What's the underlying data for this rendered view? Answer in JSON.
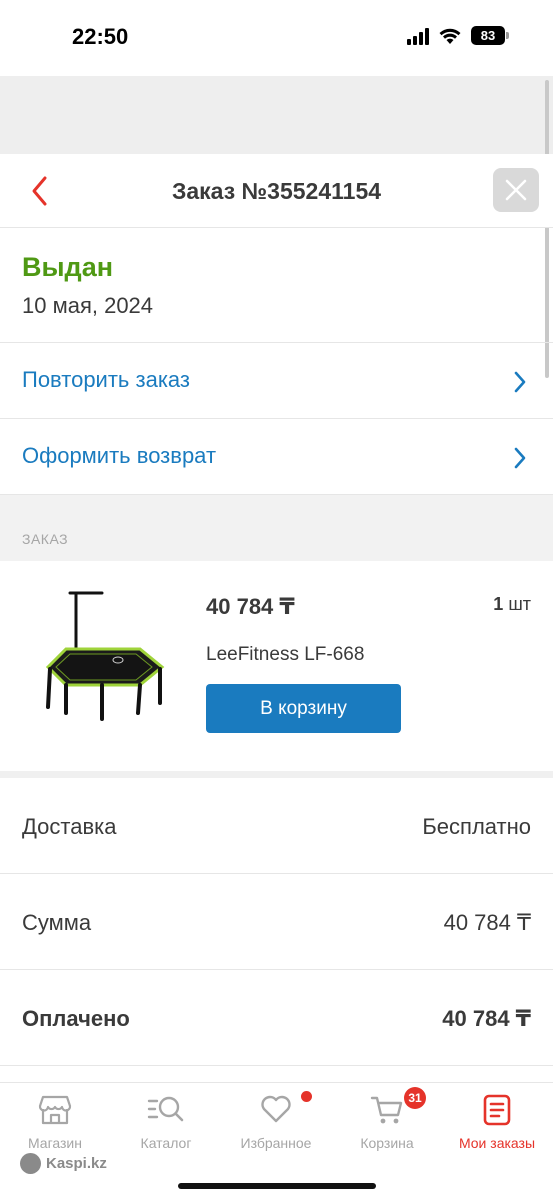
{
  "status_bar": {
    "time": "22:50",
    "battery": "83",
    "icons": [
      "signal-icon",
      "wifi-icon",
      "battery-icon"
    ]
  },
  "header": {
    "title": "Заказ №355241154",
    "back_icon": "chevron-left-icon",
    "close_icon": "close-icon"
  },
  "order_status": {
    "label": "Выдан",
    "date": "10 мая, 2024"
  },
  "actions": [
    {
      "label": "Повторить заказ",
      "icon": "chevron-right-icon"
    },
    {
      "label": "Оформить возврат",
      "icon": "chevron-right-icon"
    }
  ],
  "section": {
    "label": "ЗАКАЗ"
  },
  "product": {
    "price": "40 784 ₸",
    "qty_number": "1",
    "qty_unit": "шт",
    "name": "LeeFitness LF-668",
    "cart_button": "В корзину"
  },
  "summary": [
    {
      "key": "Доставка",
      "value": "Бесплатно"
    },
    {
      "key": "Сумма",
      "value": "40 784 ₸"
    },
    {
      "key": "Оплачено",
      "value": "40 784 ₸"
    }
  ],
  "tabs": [
    {
      "label": "Магазин",
      "icon": "store-icon"
    },
    {
      "label": "Каталог",
      "icon": "catalog-search-icon"
    },
    {
      "label": "Избранное",
      "icon": "heart-icon"
    },
    {
      "label": "Корзина",
      "icon": "cart-icon",
      "badge": "31"
    },
    {
      "label": "Мои заказы",
      "icon": "orders-icon"
    }
  ],
  "watermark": "Kaspi.kz",
  "colors": {
    "accent_red": "#e5332a",
    "link_blue": "#1a7bbf",
    "status_green": "#4f9914",
    "muted": "#a6a6a6"
  }
}
